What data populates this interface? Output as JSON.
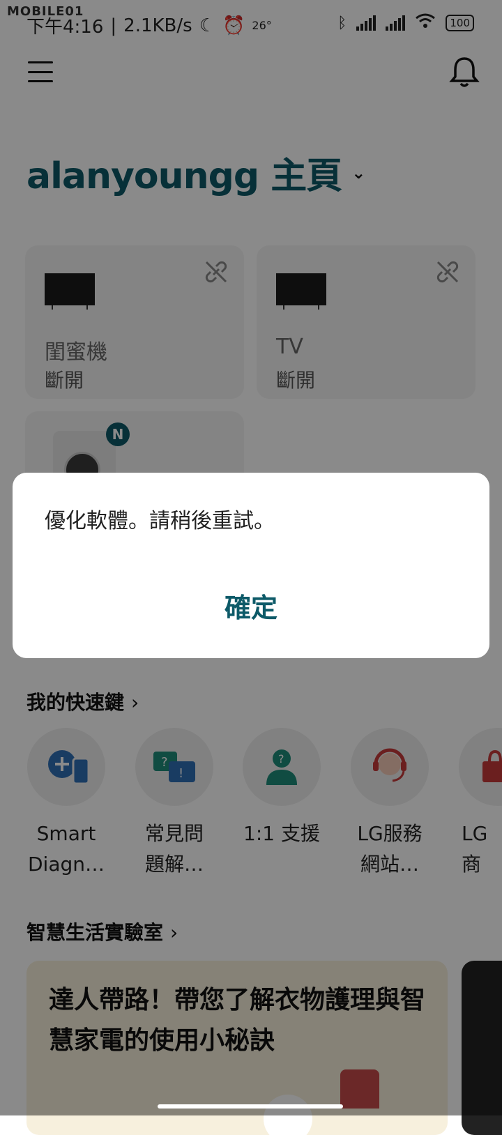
{
  "status_bar": {
    "watermark": "MOBILE01",
    "time": "下午4:16",
    "speed": "2.1KB/s",
    "temperature": "26°",
    "battery": "100"
  },
  "header": {
    "home_title": "alanyoungg 主頁"
  },
  "devices": [
    {
      "name": "閨蜜機",
      "status": "斷開"
    },
    {
      "name": "TV",
      "status": "斷開"
    },
    {
      "badge": "N"
    }
  ],
  "shortcuts": {
    "title": "我的快速鍵",
    "items": [
      {
        "label": "Smart\nDiagn…",
        "icon": "smart-diagnosis-icon"
      },
      {
        "label": "常見問\n題解…",
        "icon": "faq-icon"
      },
      {
        "label": "1:1 支援",
        "icon": "support-icon"
      },
      {
        "label": "LG服務\n網站…",
        "icon": "headset-icon"
      },
      {
        "label": "LG 商",
        "icon": "shopping-bag-icon"
      }
    ]
  },
  "lab": {
    "title": "智慧生活實驗室",
    "card_text": "達人帶路！帶您了解衣物護理與智慧家電的使用小秘訣"
  },
  "dialog": {
    "message": "優化軟體。請稍後重試。",
    "confirm_label": "確定"
  },
  "colors": {
    "accent": "#0d5a68",
    "overlay": "rgba(0,0,0,0.46)"
  }
}
